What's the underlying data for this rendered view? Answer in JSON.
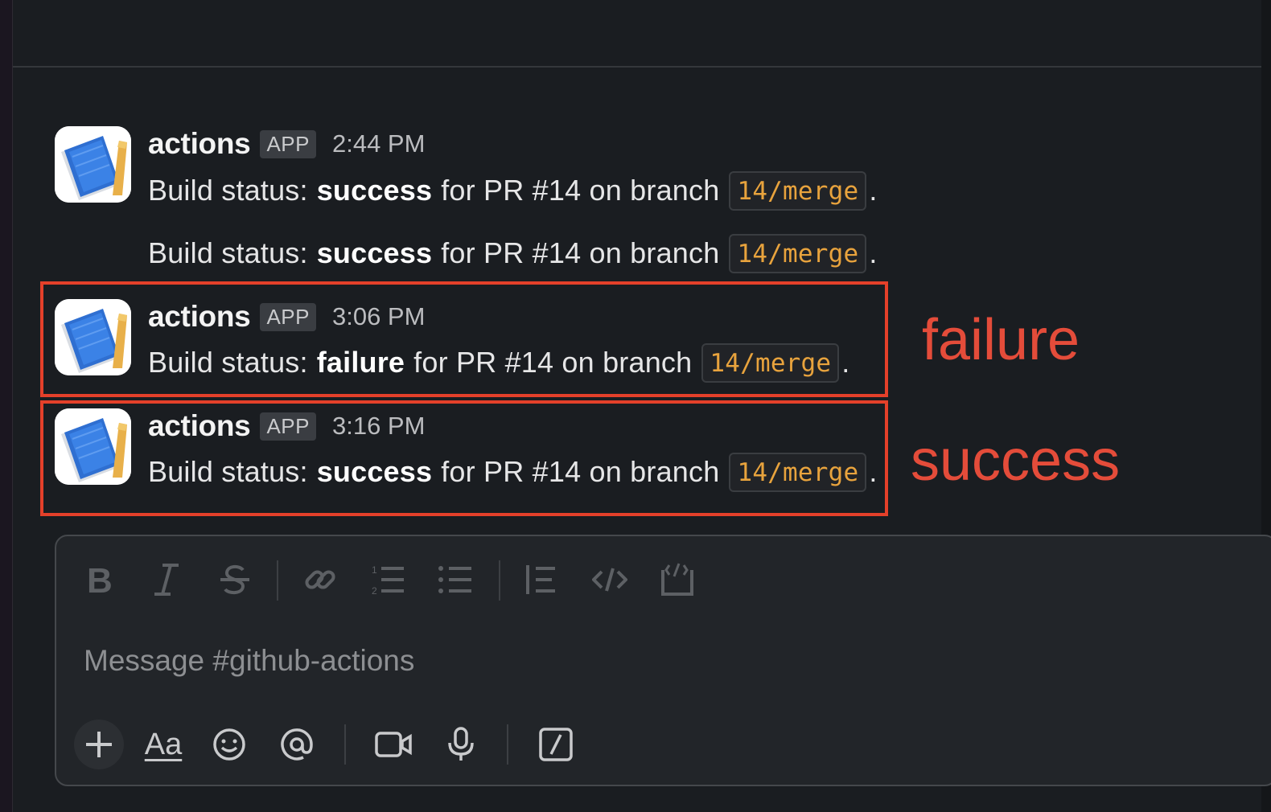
{
  "messages": [
    {
      "sender": "actions",
      "badge": "APP",
      "time": "2:44 PM",
      "lines": [
        {
          "prefix": "Build status:",
          "status": "success",
          "middle": "for PR #14 on branch",
          "branch": "14/merge",
          "end": "."
        },
        {
          "prefix": "Build status:",
          "status": "success",
          "middle": "for PR #14 on branch",
          "branch": "14/merge",
          "end": "."
        }
      ]
    },
    {
      "sender": "actions",
      "badge": "APP",
      "time": "3:06 PM",
      "lines": [
        {
          "prefix": "Build status:",
          "status": "failure",
          "middle": "for PR #14 on branch",
          "branch": "14/merge",
          "end": "."
        }
      ]
    },
    {
      "sender": "actions",
      "badge": "APP",
      "time": "3:16 PM",
      "lines": [
        {
          "prefix": "Build status:",
          "status": "success",
          "middle": "for PR #14 on branch",
          "branch": "14/merge",
          "end": "."
        }
      ]
    }
  ],
  "annotations": {
    "failure_label": "failure",
    "success_label": "success",
    "color": "#e4402a"
  },
  "composer": {
    "placeholder": "Message #github-actions",
    "formatting_tools": [
      "bold-icon",
      "italic-icon",
      "strikethrough-icon",
      "link-icon",
      "ordered-list-icon",
      "bulleted-list-icon",
      "blockquote-icon",
      "code-icon",
      "code-block-icon"
    ],
    "action_tools": [
      "plus-icon",
      "text-formatting-icon",
      "emoji-icon",
      "mention-icon",
      "video-icon",
      "microphone-icon",
      "slash-command-icon"
    ],
    "text_format_label": "Aa"
  },
  "colors": {
    "background": "#1a1d21",
    "code_text": "#e8a33d",
    "annotation": "#e4402a"
  }
}
